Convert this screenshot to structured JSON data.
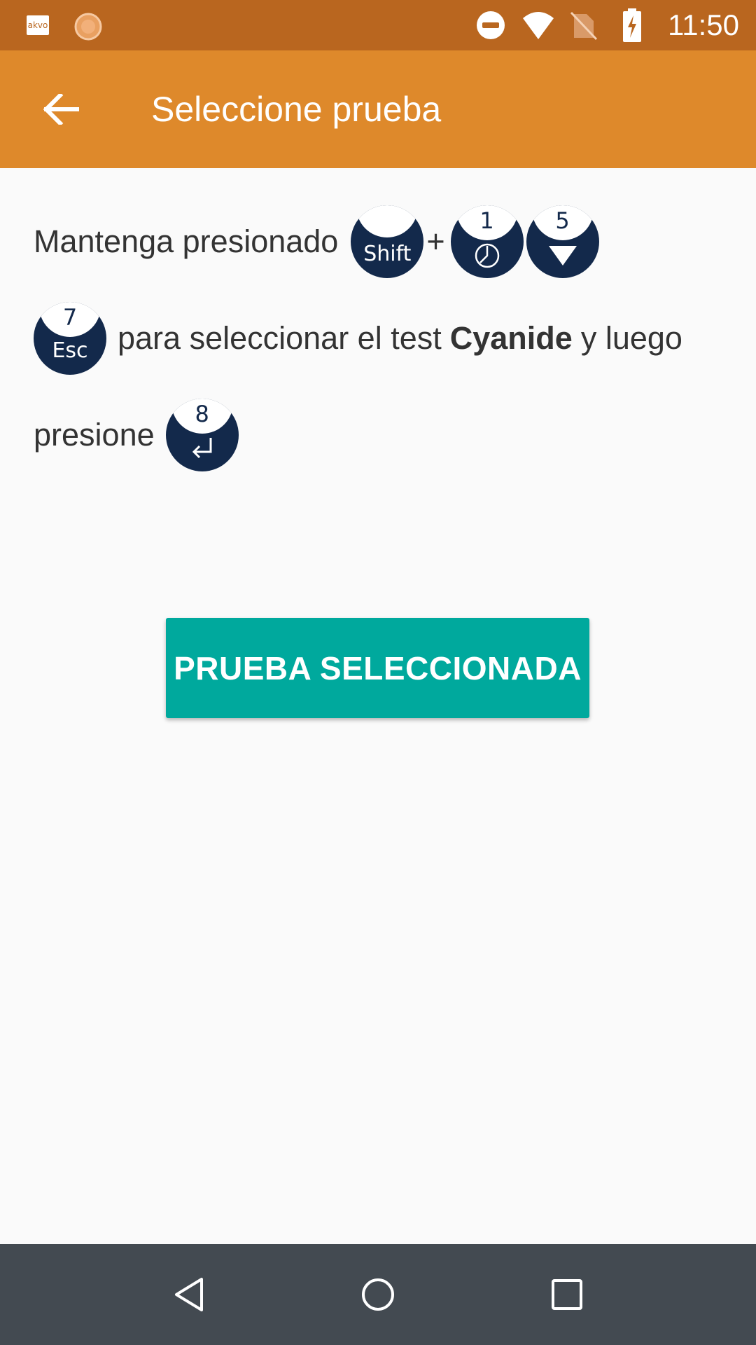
{
  "status_bar": {
    "time": "11:50",
    "app_icon_text": "akvo",
    "icons": [
      "akvo-icon",
      "sun-icon",
      "do-not-disturb-icon",
      "wifi-icon",
      "no-sim-icon",
      "battery-charging-icon"
    ]
  },
  "app_bar": {
    "title": "Seleccione prueba",
    "back_icon": "arrow-back-icon"
  },
  "instructions": {
    "part1": "Mantenga presionado",
    "plus": "+",
    "part2": "para seleccionar el test",
    "test_name": "Cyanide",
    "part3": "y luego",
    "part4": "presione",
    "keys": {
      "shift": {
        "number": "",
        "label": "Shift"
      },
      "key1": {
        "number": "1",
        "glyph": "clock-icon"
      },
      "key5": {
        "number": "5",
        "glyph": "down-triangle-icon"
      },
      "key7": {
        "number": "7",
        "label": "Esc"
      },
      "key8": {
        "number": "8",
        "glyph": "enter-arrow-icon"
      }
    }
  },
  "button": {
    "label": "PRUEBA SELECCIONADA"
  },
  "nav_bar": {
    "icons": [
      "nav-back-icon",
      "nav-home-icon",
      "nav-recent-icon"
    ]
  },
  "colors": {
    "status_bar": "#b9661f",
    "app_bar": "#de892b",
    "button": "#00a99d",
    "key": "#13294b",
    "nav_bar": "#434a51"
  }
}
